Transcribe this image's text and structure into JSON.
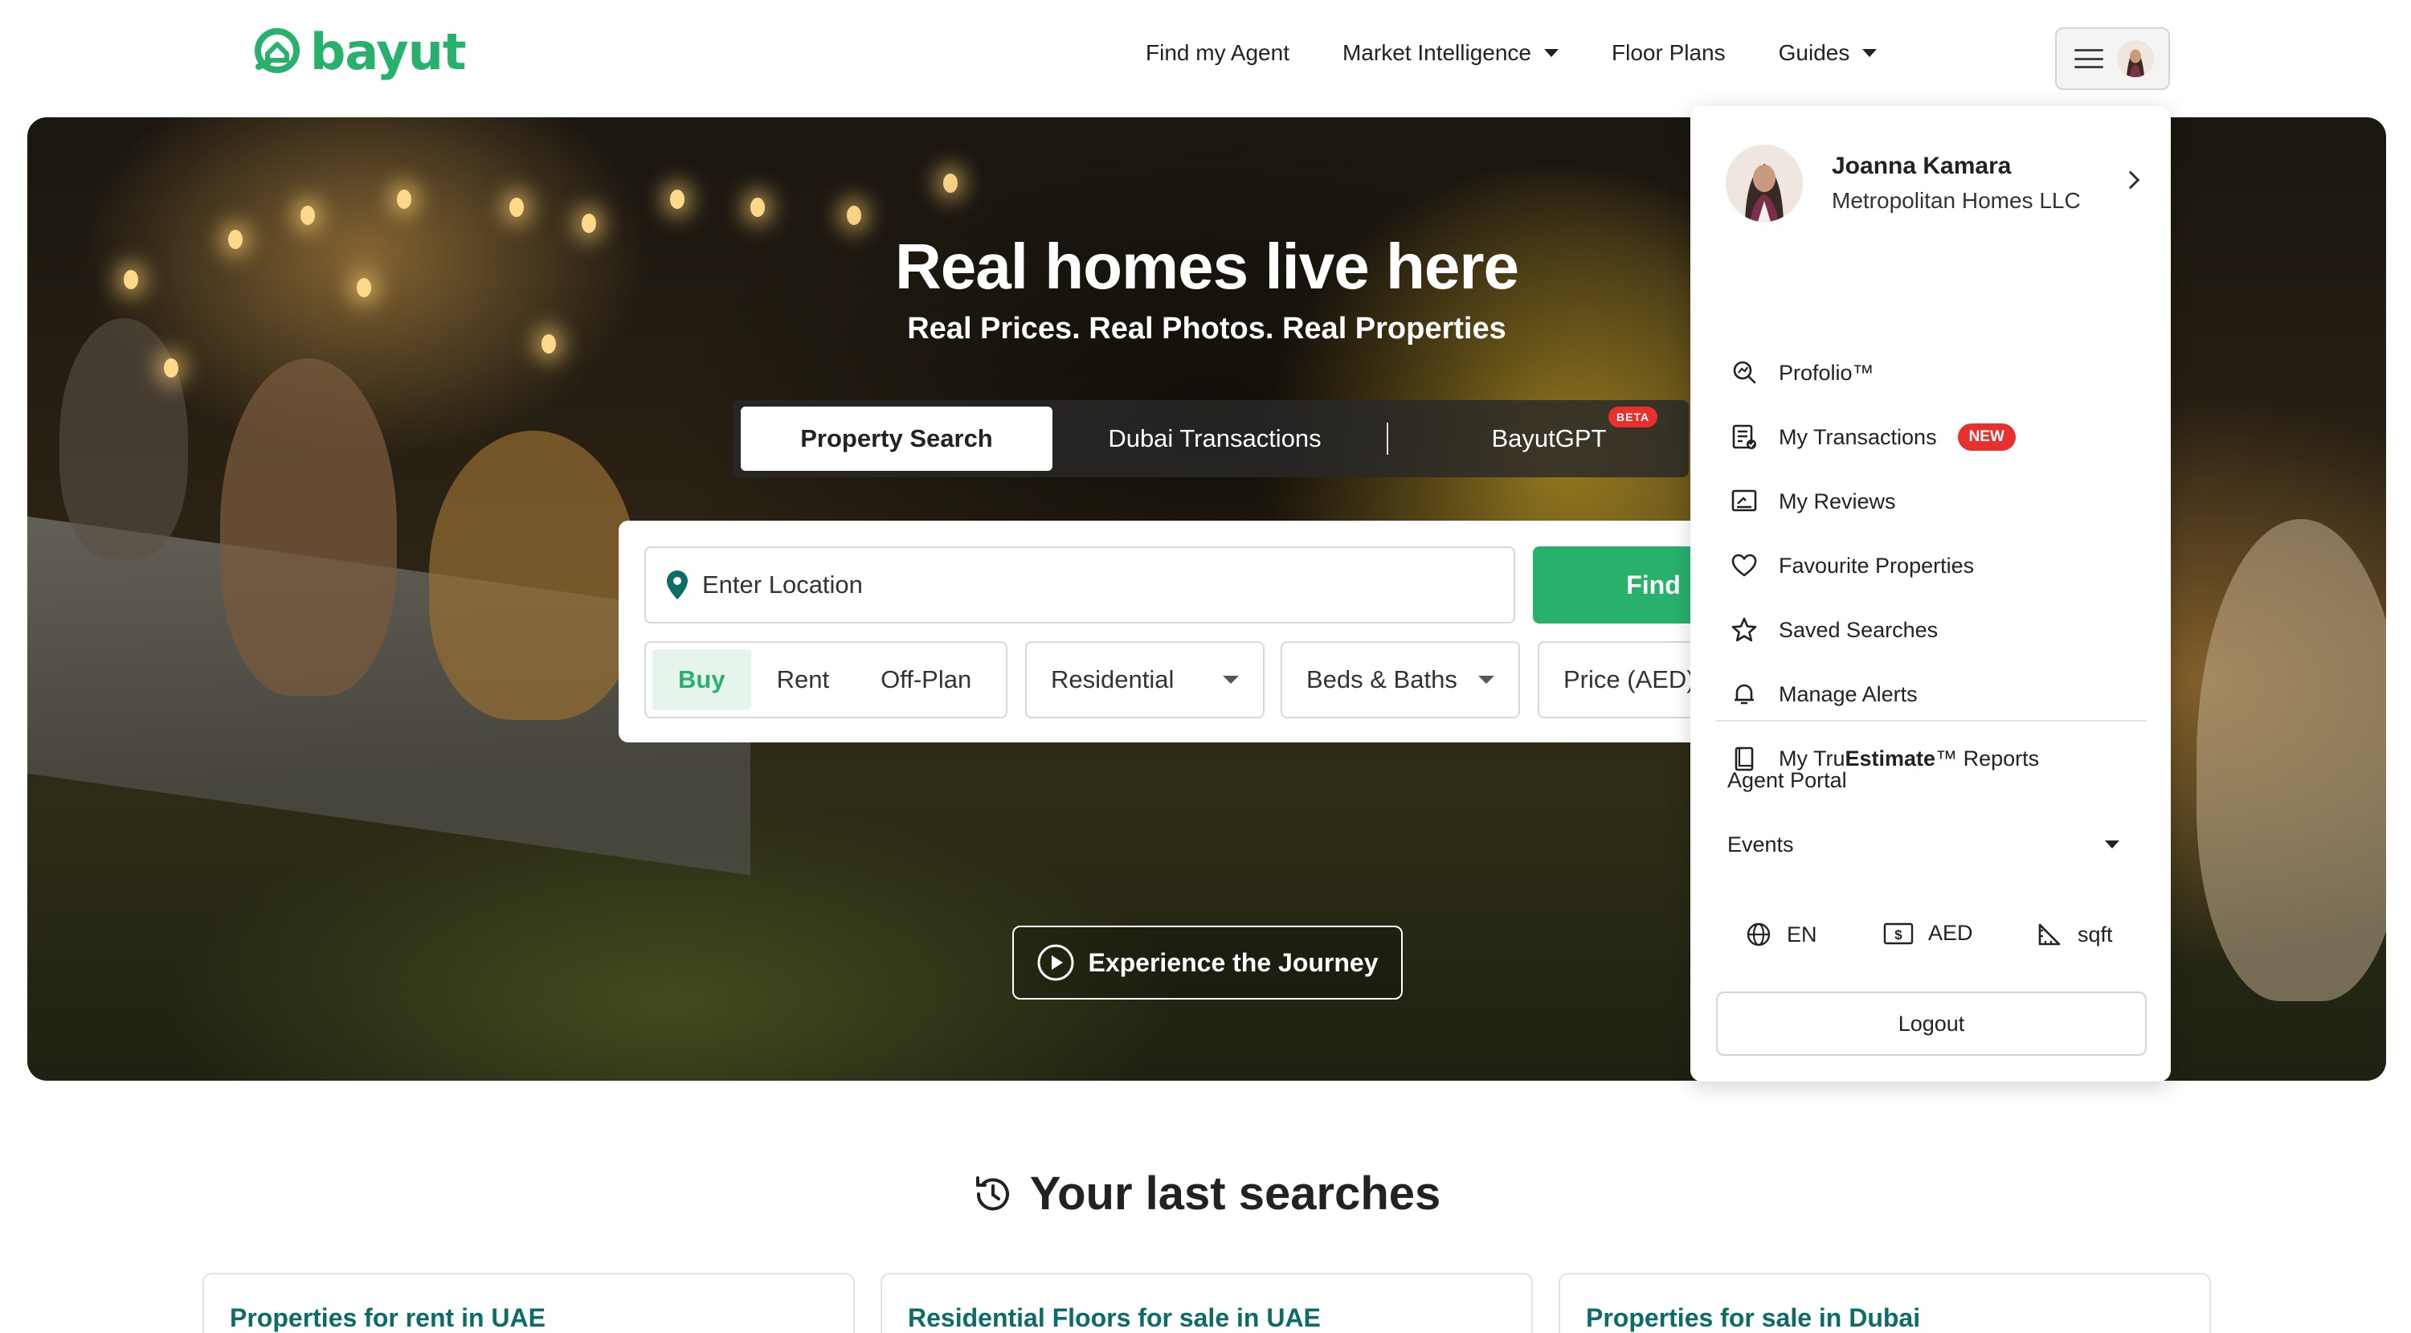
{
  "brand": {
    "name": "bayut",
    "color": "#28b16d"
  },
  "nav": [
    {
      "label": "Find my Agent",
      "has_caret": false
    },
    {
      "label": "Market Intelligence",
      "has_caret": true
    },
    {
      "label": "Floor Plans",
      "has_caret": false
    },
    {
      "label": "Guides",
      "has_caret": true
    }
  ],
  "hero": {
    "title": "Real homes live here",
    "subtitle": "Real Prices. Real Photos. Real Properties",
    "tabs": [
      {
        "label": "Property Search",
        "active": true
      },
      {
        "label": "Dubai Transactions",
        "active": false
      },
      {
        "label": "BayutGPT",
        "active": false,
        "badge": "BETA"
      }
    ],
    "search": {
      "location_placeholder": "Enter Location",
      "find_label": "Find",
      "purpose_options": [
        "Buy",
        "Rent",
        "Off-Plan"
      ],
      "purpose_selected": "Buy",
      "type_label": "Residential",
      "beds_label": "Beds & Baths",
      "price_label": "Price (AED)"
    },
    "journey_label": "Experience the Journey"
  },
  "account_menu": {
    "user_name": "Joanna Kamara",
    "company": "Metropolitan Homes LLC",
    "items": [
      {
        "label": "Profolio™",
        "icon": "profolio-icon"
      },
      {
        "label": "My Transactions",
        "icon": "transactions-icon",
        "badge": "NEW"
      },
      {
        "label": "My Reviews",
        "icon": "reviews-icon"
      },
      {
        "label": "Favourite Properties",
        "icon": "heart-icon"
      },
      {
        "label": "Saved Searches",
        "icon": "star-icon"
      },
      {
        "label": "Manage Alerts",
        "icon": "bell-icon"
      },
      {
        "label_prefix": "My Tru",
        "label_bold": "Estimate",
        "label_suffix": "™ Reports",
        "icon": "report-icon"
      }
    ],
    "agent_portal": "Agent Portal",
    "events": "Events",
    "language": "EN",
    "currency": "AED",
    "area_unit": "sqft",
    "logout": "Logout"
  },
  "last_searches": {
    "title": "Your last searches",
    "cards": [
      "Properties for rent in UAE",
      "Residential Floors for sale in UAE",
      "Properties for sale in Dubai"
    ]
  },
  "colors": {
    "green": "#28b16d",
    "teal": "#0c6d68",
    "badge_red": "#e8312f"
  }
}
